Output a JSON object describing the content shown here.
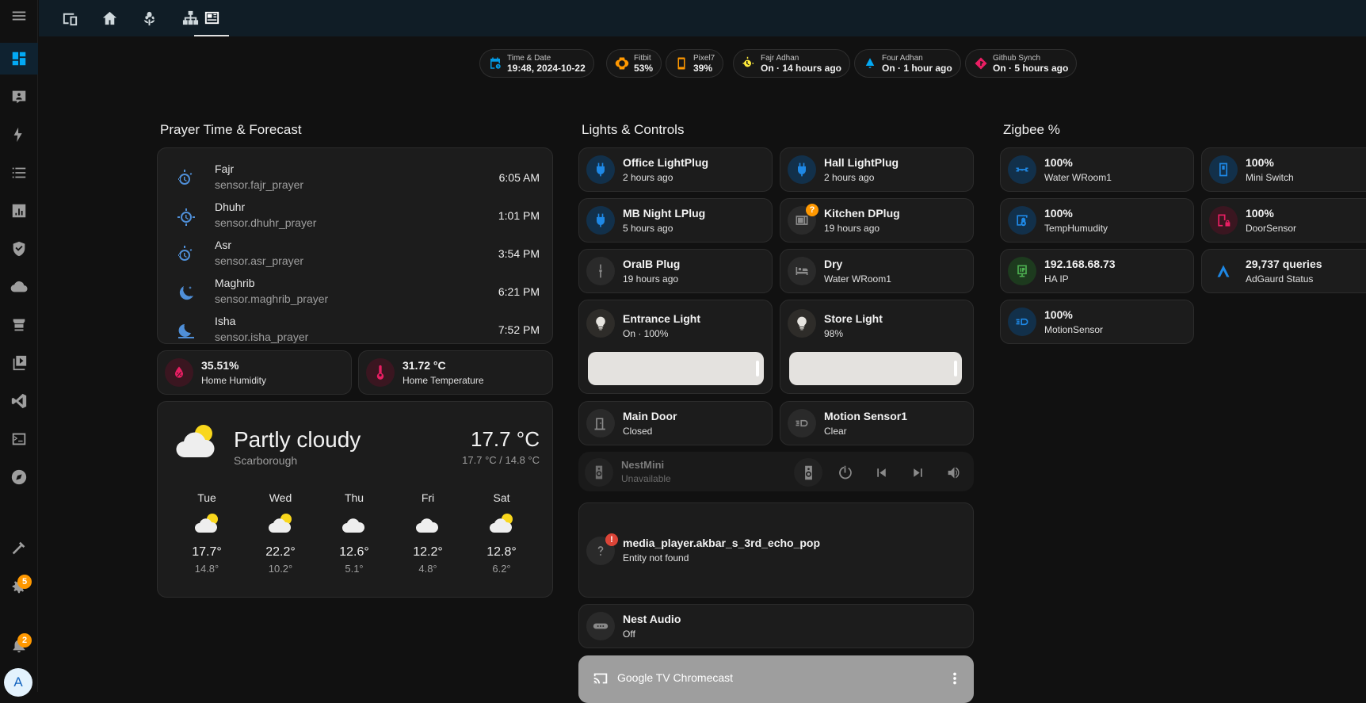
{
  "sidebar": {
    "items": [
      {
        "icon": "menu-icon"
      },
      {
        "icon": "dashboard-icon"
      },
      {
        "icon": "person-board-icon"
      },
      {
        "icon": "lightning-icon"
      },
      {
        "icon": "list-icon"
      },
      {
        "icon": "chart-icon"
      },
      {
        "icon": "shield-check-icon"
      },
      {
        "icon": "cloud-icon"
      },
      {
        "icon": "hacs-store-icon"
      },
      {
        "icon": "media-icon"
      },
      {
        "icon": "vscode-icon"
      },
      {
        "icon": "terminal-icon"
      },
      {
        "icon": "compass-icon"
      },
      {
        "icon": "hammer-icon"
      },
      {
        "icon": "gear-icon",
        "badge": "5"
      },
      {
        "icon": "bell-icon",
        "badge": "2"
      }
    ],
    "avatar": "A"
  },
  "topbar": {
    "views": [
      "devices-view-icon",
      "home-view-icon",
      "flower-view-icon",
      "network-view-icon",
      "newspaper-view-icon"
    ]
  },
  "chips": [
    {
      "label": "Time & Date",
      "value": "19:48, 2024-10-22",
      "color": "#039be5"
    },
    {
      "label": "Fitbit",
      "value": "53%",
      "color": "#ff9800"
    },
    {
      "label": "Pixel7",
      "value": "39%",
      "color": "#ff9800"
    },
    {
      "label": "Fajr Adhan",
      "value": "On · 14 hours ago",
      "color": "#ffeb3b"
    },
    {
      "label": "Four Adhan",
      "value": "On · 1 hour ago",
      "color": "#03a9f4"
    },
    {
      "label": "Github Synch",
      "value": "On · 5 hours ago",
      "color": "#e91e63"
    }
  ],
  "prayer": {
    "title": "Prayer Time & Forecast",
    "rows": [
      {
        "name": "Fajr",
        "entity": "sensor.fajr_prayer",
        "time": "6:05 AM"
      },
      {
        "name": "Dhuhr",
        "entity": "sensor.dhuhr_prayer",
        "time": "1:01 PM"
      },
      {
        "name": "Asr",
        "entity": "sensor.asr_prayer",
        "time": "3:54 PM"
      },
      {
        "name": "Maghrib",
        "entity": "sensor.maghrib_prayer",
        "time": "6:21 PM"
      },
      {
        "name": "Isha",
        "entity": "sensor.isha_prayer",
        "time": "7:52 PM"
      }
    ]
  },
  "home": {
    "humidity": {
      "value": "35.51%",
      "label": "Home Humidity"
    },
    "temperature": {
      "value": "31.72 °C",
      "label": "Home Temperature"
    }
  },
  "weather": {
    "condition": "Partly cloudy",
    "location": "Scarborough",
    "temp": "17.7 °C",
    "range": "17.7 °C / 14.8 °C",
    "forecast": [
      {
        "day": "Tue",
        "hi": "17.7°",
        "lo": "14.8°",
        "icon": "partly-cloudy-icon"
      },
      {
        "day": "Wed",
        "hi": "22.2°",
        "lo": "10.2°",
        "icon": "partly-cloudy-icon"
      },
      {
        "day": "Thu",
        "hi": "12.6°",
        "lo": "5.1°",
        "icon": "cloudy-icon"
      },
      {
        "day": "Fri",
        "hi": "12.2°",
        "lo": "4.8°",
        "icon": "cloudy-icon"
      },
      {
        "day": "Sat",
        "hi": "12.8°",
        "lo": "6.2°",
        "icon": "partly-cloudy-icon"
      }
    ]
  },
  "lights": {
    "title": "Lights & Controls",
    "office": {
      "name": "Office LightPlug",
      "state": "2 hours ago"
    },
    "hall": {
      "name": "Hall LightPlug",
      "state": "2 hours ago"
    },
    "mb": {
      "name": "MB Night LPlug",
      "state": "5 hours ago"
    },
    "kitchen": {
      "name": "Kitchen DPlug",
      "state": "19 hours ago",
      "badge": "?"
    },
    "oralb": {
      "name": "OralB Plug",
      "state": "19 hours ago"
    },
    "dry": {
      "name": "Dry",
      "state": "Water WRoom1"
    },
    "entrance": {
      "name": "Entrance Light",
      "state": "On · 100%",
      "level": 1.0
    },
    "store": {
      "name": "Store Light",
      "state": "98%",
      "level": 0.98
    },
    "maindoor": {
      "name": "Main Door",
      "state": "Closed"
    },
    "motion": {
      "name": "Motion Sensor1",
      "state": "Clear"
    },
    "nestmini": {
      "name": "NestMini",
      "state": "Unavailable"
    },
    "echo": {
      "name": "media_player.akbar_s_3rd_echo_pop",
      "state": "Entity not found",
      "badge": "!"
    },
    "nestaudio": {
      "name": "Nest Audio",
      "state": "Off"
    },
    "chromecast": {
      "name": "Google TV Chromecast"
    }
  },
  "zigbee": {
    "title": "Zigbee %",
    "water": {
      "value": "100%",
      "label": "Water WRoom1"
    },
    "mini": {
      "value": "100%",
      "label": "Mini Switch"
    },
    "temphum": {
      "value": "100%",
      "label": "TempHumudity"
    },
    "door": {
      "value": "100%",
      "label": "DoorSensor"
    },
    "haip": {
      "value": "192.168.68.73",
      "label": "HA IP"
    },
    "adguard": {
      "value": "29,737 queries",
      "label": "AdGaurd Status"
    },
    "motion": {
      "value": "100%",
      "label": "MotionSensor"
    }
  }
}
